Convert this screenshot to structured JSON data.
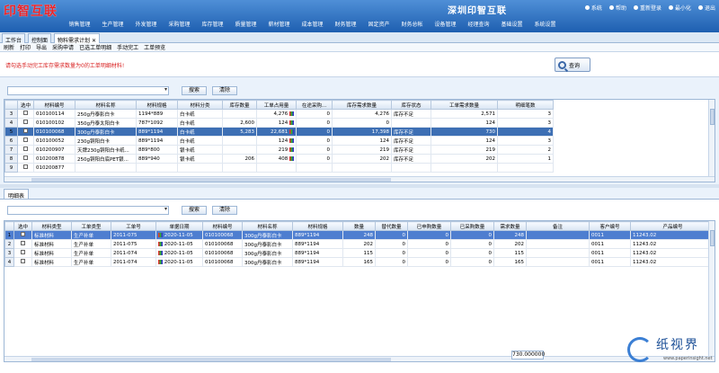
{
  "app": {
    "logo": "印智互联",
    "company": "深圳印智互联",
    "sys_buttons": [
      "系统",
      "帮助",
      "重新登录",
      "最小化",
      "退出"
    ],
    "menu": [
      "销售管理",
      "生产管理",
      "外发管理",
      "采购管理",
      "库存管理",
      "质量管理",
      "薪材管理",
      "成本管理",
      "财务管理",
      "固定资产",
      "财务总帐",
      "设备管理",
      "经理查询",
      "基础设置",
      "系统设置"
    ]
  },
  "tabs": [
    "工作台",
    "控制面",
    "物料需求计划"
  ],
  "toolbar": [
    "刷新",
    "打印",
    "导出",
    "采购申请",
    "已选工单明细",
    "手动完工",
    "工单预览"
  ],
  "hint": "请勾选手动完工库存需求数量为0的工单明细材料!",
  "query_label": "查询",
  "search_label": "搜索",
  "clear_label": "清除",
  "upper_table": {
    "headers": [
      "选中",
      "材料编号",
      "材料名称",
      "材料规格",
      "材料分类",
      "库存数量",
      "工单占用量",
      "在途采购...",
      "库存需求数量",
      "库存状态",
      "工单需求数量",
      "明细笔数"
    ],
    "rows": [
      {
        "rh": "3",
        "code": "010100114",
        "name": "250g丹泰影白卡",
        "spec": "1194*889",
        "cat": "白卡纸",
        "stock": "",
        "occupy": "4,276",
        "transit": "0",
        "need": "4,276",
        "status": "库存不足",
        "order_need": "2,571",
        "count": "3"
      },
      {
        "rh": "4",
        "code": "010100102",
        "name": "350g丹泰太阳白卡",
        "spec": "787*1092",
        "cat": "白卡纸",
        "stock": "2,600",
        "occupy": "124",
        "transit": "0",
        "need": "0",
        "status": "",
        "order_need": "124",
        "count": "3"
      },
      {
        "rh": "5",
        "code": "010100068",
        "name": "300g丹泰影白卡",
        "spec": "889*1194",
        "cat": "白卡纸",
        "stock": "5,283",
        "occupy": "22,681",
        "transit": "0",
        "need": "17,398",
        "status": "库存不足",
        "order_need": "730",
        "count": "4"
      },
      {
        "rh": "6",
        "code": "010100052",
        "name": "230g铜阳白卡",
        "spec": "889*1194",
        "cat": "白卡纸",
        "stock": "",
        "occupy": "124",
        "transit": "0",
        "need": "124",
        "status": "库存不足",
        "order_need": "124",
        "count": "3"
      },
      {
        "rh": "7",
        "code": "010200907",
        "name": "天牌230g铜阳白卡纸...",
        "spec": "889*800",
        "cat": "银卡纸",
        "stock": "",
        "occupy": "219",
        "transit": "0",
        "need": "219",
        "status": "库存不足",
        "order_need": "219",
        "count": "2"
      },
      {
        "rh": "8",
        "code": "010200878",
        "name": "250g铜阳白底PET银...",
        "spec": "889*940",
        "cat": "银卡纸",
        "stock": "206",
        "occupy": "408",
        "transit": "0",
        "need": "202",
        "status": "库存不足",
        "order_need": "202",
        "count": "1"
      },
      {
        "rh": "9",
        "code": "010200877",
        "name": "",
        "spec": "",
        "cat": "",
        "stock": "",
        "occupy": "",
        "transit": "",
        "need": "",
        "status": "",
        "order_need": "",
        "count": ""
      }
    ]
  },
  "section_tab": "明细表",
  "lower_table": {
    "headers": [
      "选中",
      "材料类型",
      "工单类型",
      "工单号",
      "单据日期",
      "材料编号",
      "材料名称",
      "材料规格",
      "数量",
      "替代数量",
      "已申购数量",
      "已采购数量",
      "需求数量",
      "备注",
      "客户编号",
      "产品编号"
    ],
    "rows": [
      {
        "rh": "1",
        "type": "标准材料",
        "otype": "生产补单",
        "no": "2011-075",
        "date": "2020-11-05",
        "code": "010100068",
        "name": "300g丹泰影白卡",
        "spec": "889*1194",
        "qty": "248",
        "alt": "0",
        "applied": "0",
        "purchased": "0",
        "need": "248",
        "note": "",
        "cust": "0011",
        "prod": "11243.02"
      },
      {
        "rh": "2",
        "type": "标准材料",
        "otype": "生产补单",
        "no": "2011-075",
        "date": "2020-11-05",
        "code": "010100068",
        "name": "300g丹泰影白卡",
        "spec": "889*1194",
        "qty": "202",
        "alt": "0",
        "applied": "0",
        "purchased": "0",
        "need": "202",
        "note": "",
        "cust": "0011",
        "prod": "11243.02"
      },
      {
        "rh": "3",
        "type": "标准材料",
        "otype": "生产补单",
        "no": "2011-074",
        "date": "2020-11-05",
        "code": "010100068",
        "name": "300g丹泰影白卡",
        "spec": "889*1194",
        "qty": "115",
        "alt": "0",
        "applied": "0",
        "purchased": "0",
        "need": "115",
        "note": "",
        "cust": "0011",
        "prod": "11243.02"
      },
      {
        "rh": "4",
        "type": "标准材料",
        "otype": "生产补单",
        "no": "2011-074",
        "date": "2020-11-05",
        "code": "010100068",
        "name": "300g丹泰影白卡",
        "spec": "889*1194",
        "qty": "165",
        "alt": "0",
        "applied": "0",
        "purchased": "0",
        "need": "165",
        "note": "",
        "cust": "0011",
        "prod": "11243.02"
      }
    ]
  },
  "footer_sum": "730.000000",
  "watermark": {
    "text": "纸视界",
    "url": "www.paperinsight.net"
  }
}
